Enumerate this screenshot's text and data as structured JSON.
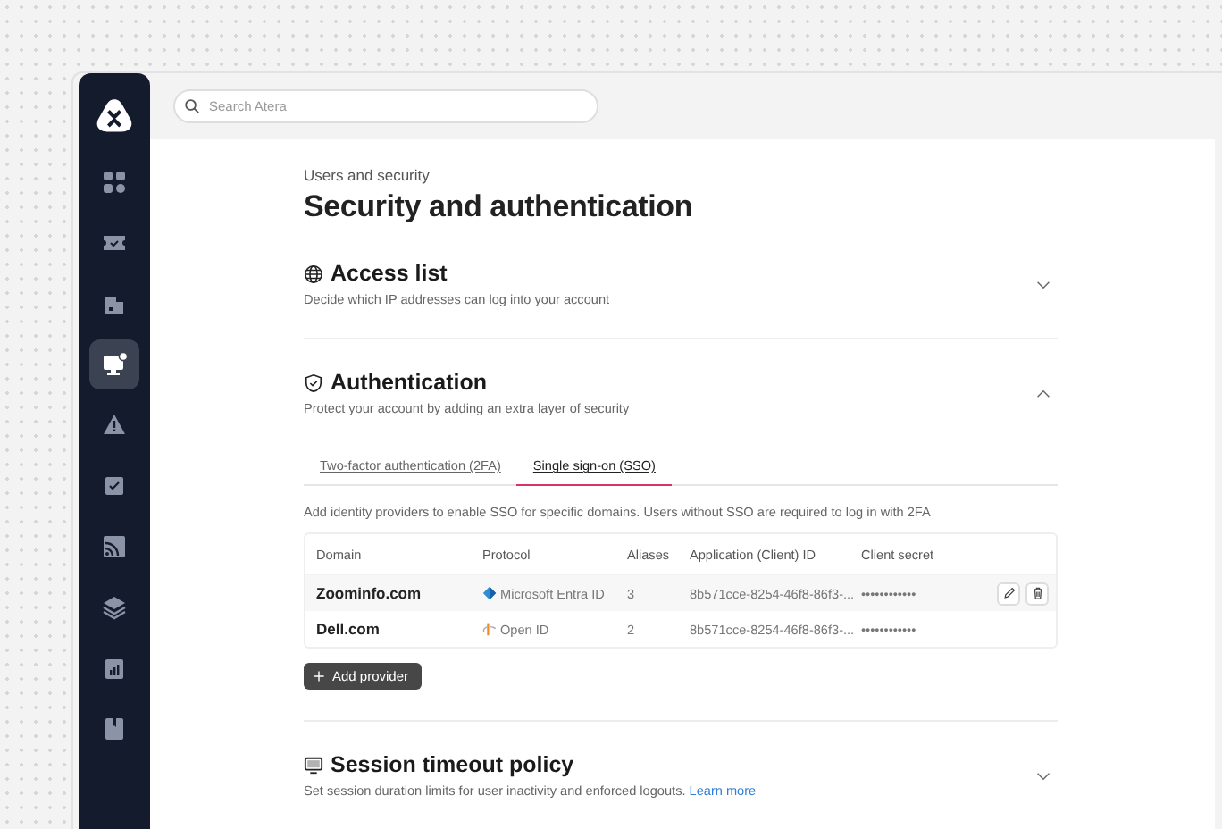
{
  "sidebar": {
    "items": [
      {
        "selected": false
      },
      {
        "selected": false
      },
      {
        "selected": false
      },
      {
        "selected": true
      },
      {
        "selected": false
      },
      {
        "selected": false
      },
      {
        "selected": false
      },
      {
        "selected": false
      },
      {
        "selected": false
      },
      {
        "selected": false
      }
    ]
  },
  "search": {
    "placeholder": "Search Atera"
  },
  "breadcrumb": "Users and security",
  "title": "Security and authentication",
  "sections": [
    {
      "kind": "globe",
      "title": "Access list",
      "description": "Decide which IP addresses can log into your account",
      "expanded": false
    },
    {
      "kind": "shield",
      "title": "Authentication",
      "description": "Protect your account by adding an extra layer of security",
      "expanded": true,
      "tabs": [
        {
          "label": "Two-factor authentication (2FA)",
          "selected": false
        },
        {
          "label": "Single sign-on (SSO)",
          "selected": true
        }
      ],
      "note": "Add identity providers to enable SSO for specific domains. Users without SSO are required to log in with 2FA",
      "table": {
        "columns": [
          "Domain",
          "Protocol",
          "Aliases",
          "Application (Client) ID",
          "Client secret"
        ],
        "rows": [
          {
            "domain": "Zoominfo.com",
            "protocol": {
              "kind": "entra",
              "label": "Microsoft Entra ID"
            },
            "aliases": "3",
            "client_id": "8b571cce-8254-46f8-86f3-...",
            "secret": "••••••••••••",
            "hovered": true
          },
          {
            "domain": "Dell.com",
            "protocol": {
              "kind": "openid",
              "label": "Open ID"
            },
            "aliases": "2",
            "client_id": "8b571cce-8254-46f8-86f3-...",
            "secret": "••••••••••••",
            "hovered": false
          }
        ]
      },
      "add_button": "Add provider"
    },
    {
      "kind": "monitor",
      "title": "Session timeout policy",
      "description": "Set session duration limits for user inactivity and enforced logouts.",
      "link": "Learn more",
      "expanded": false
    }
  ]
}
